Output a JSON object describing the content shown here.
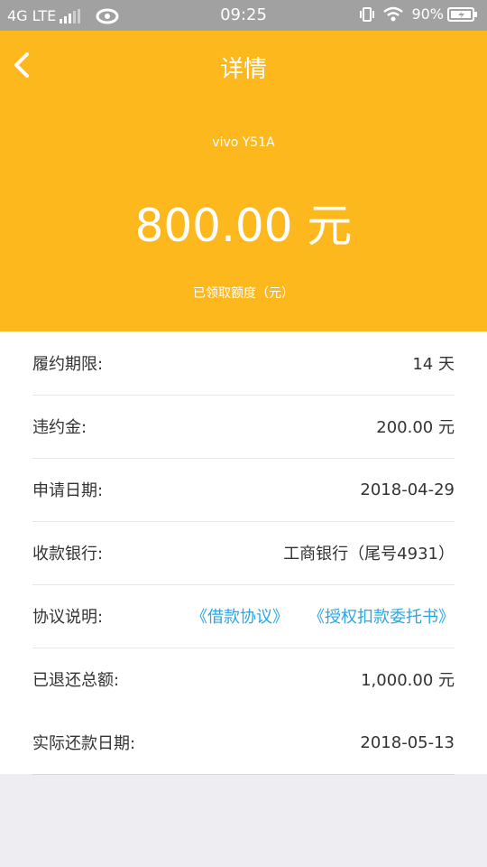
{
  "status_bar": {
    "network": "4G LTE",
    "time": "09:25",
    "battery": "90%"
  },
  "header": {
    "title": "详情",
    "device": "vivo Y51A",
    "amount": "800.00 元",
    "amount_label": "已领取额度（元）",
    "background_color": "#fdb81e"
  },
  "details": {
    "rows": [
      {
        "label": "履约期限:",
        "value": "14 天"
      },
      {
        "label": "违约金:",
        "value": "200.00 元"
      },
      {
        "label": "申请日期:",
        "value": "2018-04-29"
      },
      {
        "label": "收款银行:",
        "value": "工商银行（尾号4931）"
      },
      {
        "label": "协议说明:",
        "links": [
          "《借款协议》",
          "《授权扣款委托书》"
        ]
      },
      {
        "label": "已退还总额:",
        "value": "1,000.00 元"
      },
      {
        "label": "实际还款日期:",
        "value": "2018-05-13"
      }
    ],
    "link_color": "#2aa7e4"
  }
}
